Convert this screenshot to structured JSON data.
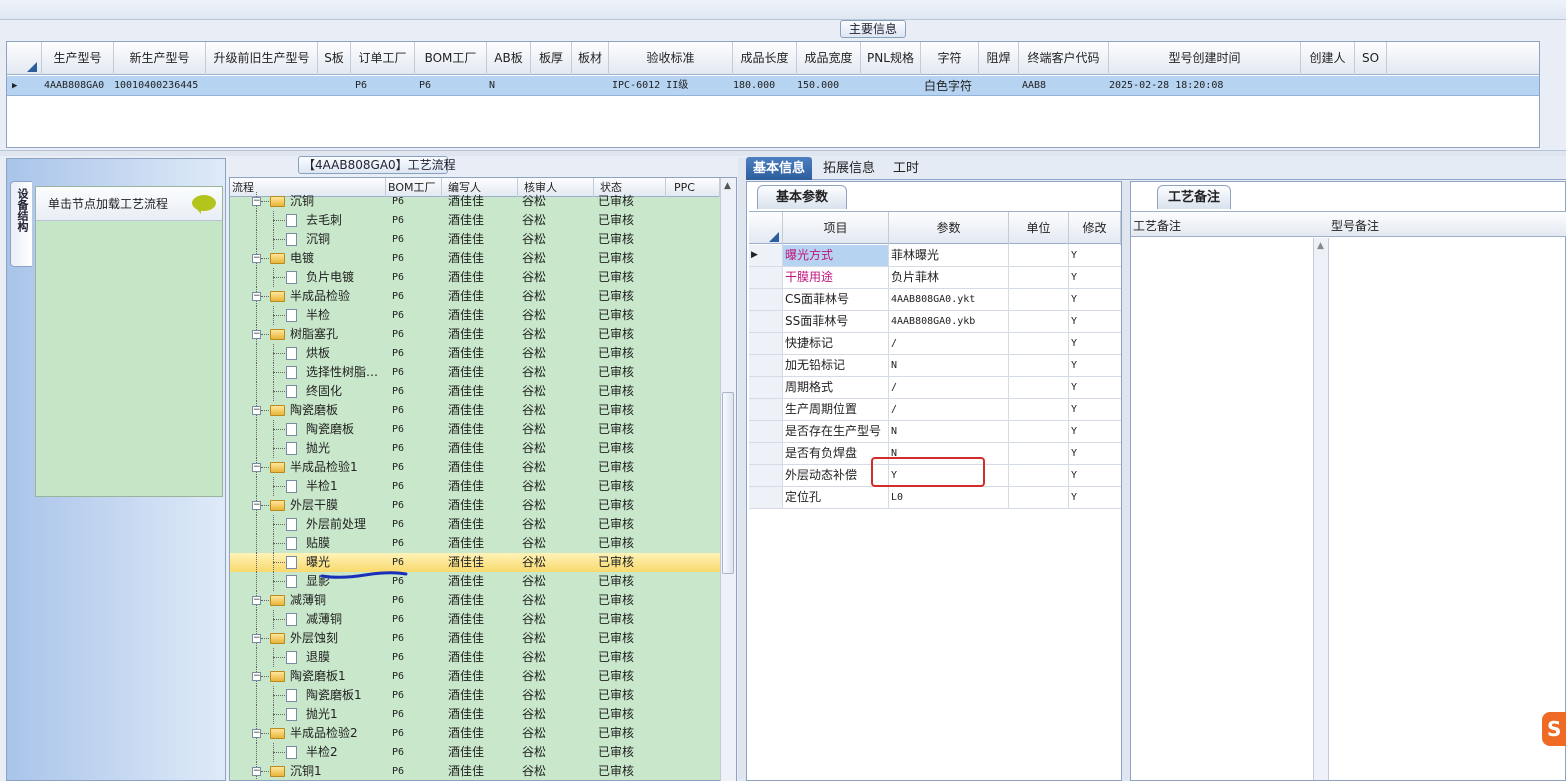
{
  "main_info": {
    "title": "主要信息",
    "columns": [
      "生产型号",
      "新生产型号",
      "升级前旧生产型号",
      "S板",
      "订单工厂",
      "BOM工厂",
      "AB板",
      "板厚",
      "板材",
      "验收标准",
      "成品长度",
      "成品宽度",
      "PNL规格",
      "字符",
      "阻焊",
      "终端客户代码",
      "型号创建时间",
      "创建人",
      "SO"
    ],
    "row": {
      "prod_model": "4AAB808GA0",
      "new_model": "10010400236445",
      "order_factory": "P6",
      "bom_factory": "P6",
      "ab_board": "N",
      "standard": "IPC-6012 II级",
      "length": "180.000",
      "width": "150.000",
      "char": "白色字符",
      "customer_code": "AAB8",
      "create_time": "2025-02-28 18:20:08"
    }
  },
  "left_panel": {
    "vertical_tab": "设备结构",
    "hint": "单击节点加载工艺流程",
    "hint_icon": "speech-bubble-icon"
  },
  "flow": {
    "title": "【4AAB808GA0】工艺流程",
    "columns": [
      "流程",
      "BOM工厂",
      "编写人",
      "核审人",
      "状态",
      "PPC"
    ],
    "rows": [
      {
        "name": "沉铜",
        "type": "folder",
        "factory": "P6",
        "writer": "酒佳佳",
        "reviewer": "谷松",
        "status": "已审核"
      },
      {
        "name": "去毛刺",
        "type": "doc",
        "factory": "P6",
        "writer": "酒佳佳",
        "reviewer": "谷松",
        "status": "已审核"
      },
      {
        "name": "沉铜",
        "type": "doc",
        "factory": "P6",
        "writer": "酒佳佳",
        "reviewer": "谷松",
        "status": "已审核"
      },
      {
        "name": "电镀",
        "type": "folder",
        "factory": "P6",
        "writer": "酒佳佳",
        "reviewer": "谷松",
        "status": "已审核"
      },
      {
        "name": "负片电镀",
        "type": "doc",
        "factory": "P6",
        "writer": "酒佳佳",
        "reviewer": "谷松",
        "status": "已审核"
      },
      {
        "name": "半成品检验",
        "type": "folder",
        "factory": "P6",
        "writer": "酒佳佳",
        "reviewer": "谷松",
        "status": "已审核"
      },
      {
        "name": "半检",
        "type": "doc",
        "factory": "P6",
        "writer": "酒佳佳",
        "reviewer": "谷松",
        "status": "已审核"
      },
      {
        "name": "树脂塞孔",
        "type": "folder",
        "factory": "P6",
        "writer": "酒佳佳",
        "reviewer": "谷松",
        "status": "已审核"
      },
      {
        "name": "烘板",
        "type": "doc",
        "factory": "P6",
        "writer": "酒佳佳",
        "reviewer": "谷松",
        "status": "已审核"
      },
      {
        "name": "选择性树脂…",
        "type": "doc",
        "factory": "P6",
        "writer": "酒佳佳",
        "reviewer": "谷松",
        "status": "已审核"
      },
      {
        "name": "终固化",
        "type": "doc",
        "factory": "P6",
        "writer": "酒佳佳",
        "reviewer": "谷松",
        "status": "已审核"
      },
      {
        "name": "陶瓷磨板",
        "type": "folder",
        "factory": "P6",
        "writer": "酒佳佳",
        "reviewer": "谷松",
        "status": "已审核"
      },
      {
        "name": "陶瓷磨板",
        "type": "doc",
        "factory": "P6",
        "writer": "酒佳佳",
        "reviewer": "谷松",
        "status": "已审核"
      },
      {
        "name": "抛光",
        "type": "doc",
        "factory": "P6",
        "writer": "酒佳佳",
        "reviewer": "谷松",
        "status": "已审核"
      },
      {
        "name": "半成品检验1",
        "type": "folder",
        "factory": "P6",
        "writer": "酒佳佳",
        "reviewer": "谷松",
        "status": "已审核"
      },
      {
        "name": "半检1",
        "type": "doc",
        "factory": "P6",
        "writer": "酒佳佳",
        "reviewer": "谷松",
        "status": "已审核"
      },
      {
        "name": "外层干膜",
        "type": "folder",
        "factory": "P6",
        "writer": "酒佳佳",
        "reviewer": "谷松",
        "status": "已审核"
      },
      {
        "name": "外层前处理",
        "type": "doc",
        "factory": "P6",
        "writer": "酒佳佳",
        "reviewer": "谷松",
        "status": "已审核"
      },
      {
        "name": "贴膜",
        "type": "doc",
        "factory": "P6",
        "writer": "酒佳佳",
        "reviewer": "谷松",
        "status": "已审核"
      },
      {
        "name": "曝光",
        "type": "doc",
        "factory": "P6",
        "writer": "酒佳佳",
        "reviewer": "谷松",
        "status": "已审核",
        "selected": true
      },
      {
        "name": "显影",
        "type": "doc",
        "factory": "P6",
        "writer": "酒佳佳",
        "reviewer": "谷松",
        "status": "已审核"
      },
      {
        "name": "减薄铜",
        "type": "folder",
        "factory": "P6",
        "writer": "酒佳佳",
        "reviewer": "谷松",
        "status": "已审核"
      },
      {
        "name": "减薄铜",
        "type": "doc",
        "factory": "P6",
        "writer": "酒佳佳",
        "reviewer": "谷松",
        "status": "已审核"
      },
      {
        "name": "外层蚀刻",
        "type": "folder",
        "factory": "P6",
        "writer": "酒佳佳",
        "reviewer": "谷松",
        "status": "已审核"
      },
      {
        "name": "退膜",
        "type": "doc",
        "factory": "P6",
        "writer": "酒佳佳",
        "reviewer": "谷松",
        "status": "已审核"
      },
      {
        "name": "陶瓷磨板1",
        "type": "folder",
        "factory": "P6",
        "writer": "酒佳佳",
        "reviewer": "谷松",
        "status": "已审核"
      },
      {
        "name": "陶瓷磨板1",
        "type": "doc",
        "factory": "P6",
        "writer": "酒佳佳",
        "reviewer": "谷松",
        "status": "已审核"
      },
      {
        "name": "抛光1",
        "type": "doc",
        "factory": "P6",
        "writer": "酒佳佳",
        "reviewer": "谷松",
        "status": "已审核"
      },
      {
        "name": "半成品检验2",
        "type": "folder",
        "factory": "P6",
        "writer": "酒佳佳",
        "reviewer": "谷松",
        "status": "已审核"
      },
      {
        "name": "半检2",
        "type": "doc",
        "factory": "P6",
        "writer": "酒佳佳",
        "reviewer": "谷松",
        "status": "已审核"
      },
      {
        "name": "沉铜1",
        "type": "folder",
        "factory": "P6",
        "writer": "酒佳佳",
        "reviewer": "谷松",
        "status": "已审核"
      }
    ]
  },
  "right_tabs": [
    "基本信息",
    "拓展信息",
    "工时"
  ],
  "params": {
    "subtab": "基本参数",
    "columns": [
      "项目",
      "参数",
      "单位",
      "修改"
    ],
    "rows": [
      {
        "item": "曝光方式",
        "value": "菲林曝光",
        "unit": "",
        "edit": "Y",
        "highlight": true
      },
      {
        "item": "干膜用途",
        "value": "负片菲林",
        "unit": "",
        "edit": "Y",
        "highlight": true
      },
      {
        "item": "CS面菲林号",
        "value": "4AAB808GA0.ykt",
        "unit": "",
        "edit": "Y"
      },
      {
        "item": "SS面菲林号",
        "value": "4AAB808GA0.ykb",
        "unit": "",
        "edit": "Y"
      },
      {
        "item": "快捷标记",
        "value": "/",
        "unit": "",
        "edit": "Y"
      },
      {
        "item": "加无铅标记",
        "value": "N",
        "unit": "",
        "edit": "Y"
      },
      {
        "item": "周期格式",
        "value": "/",
        "unit": "",
        "edit": "Y"
      },
      {
        "item": "生产周期位置",
        "value": "/",
        "unit": "",
        "edit": "Y"
      },
      {
        "item": "是否存在生产型号",
        "value": "N",
        "unit": "",
        "edit": "Y"
      },
      {
        "item": "是否有负焊盘",
        "value": "N",
        "unit": "",
        "edit": "Y"
      },
      {
        "item": "外层动态补偿",
        "value": "Y",
        "unit": "",
        "edit": "Y"
      },
      {
        "item": "定位孔",
        "value": "L0",
        "unit": "",
        "edit": "Y"
      }
    ]
  },
  "notes": {
    "subtab": "工艺备注",
    "col1": "工艺备注",
    "col2": "型号备注"
  },
  "colors": {
    "accent": "#2c5d9c",
    "selection": "#f8d96c",
    "tree_bg": "#c9e7cb",
    "highlight_text": "#c0147e",
    "annotation_red": "#d22c2c",
    "annotation_blue": "#1a2fb8"
  }
}
